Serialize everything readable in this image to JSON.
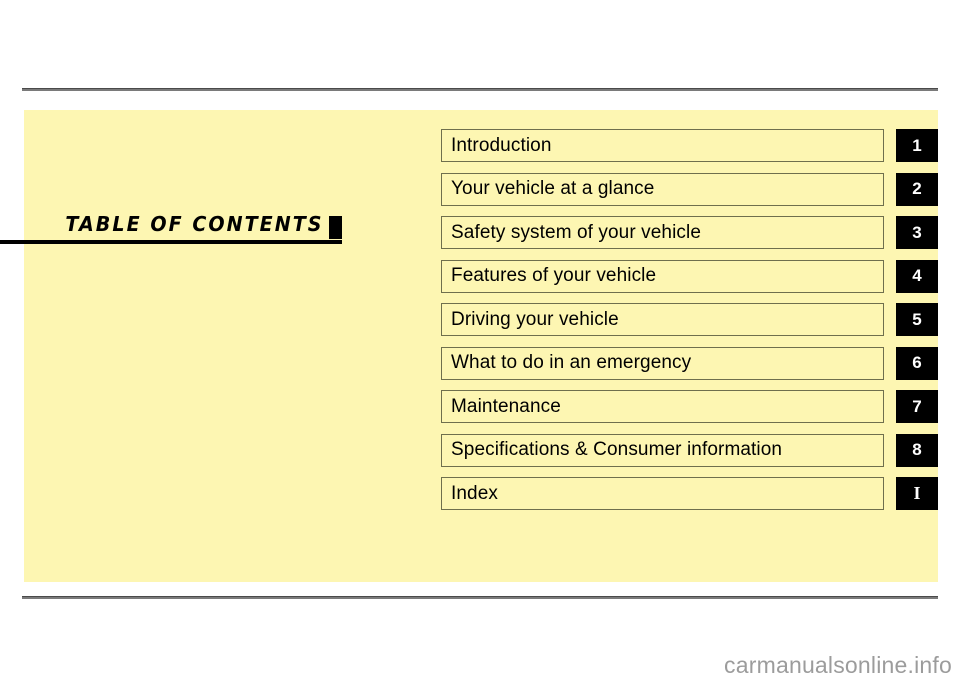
{
  "page": {
    "background_color": "#ffffff",
    "panel_color": "#fdf6b2",
    "rule_color": "#7a7a7a",
    "tab_color": "#000000",
    "box_border_color": "#6f6f4d"
  },
  "heading": {
    "title": "TABLE OF CONTENTS"
  },
  "contents": {
    "items": [
      {
        "label": "Introduction",
        "tab": "1"
      },
      {
        "label": "Your vehicle at a glance",
        "tab": "2"
      },
      {
        "label": "Safety system of your vehicle",
        "tab": "3"
      },
      {
        "label": "Features of your vehicle",
        "tab": "4"
      },
      {
        "label": "Driving your vehicle",
        "tab": "5"
      },
      {
        "label": "What to do in an emergency",
        "tab": "6"
      },
      {
        "label": "Maintenance",
        "tab": "7"
      },
      {
        "label": "Specifications & Consumer information",
        "tab": "8"
      },
      {
        "label": "Index",
        "tab": "I"
      }
    ]
  },
  "watermark": {
    "text": "carmanualsonline.info"
  }
}
